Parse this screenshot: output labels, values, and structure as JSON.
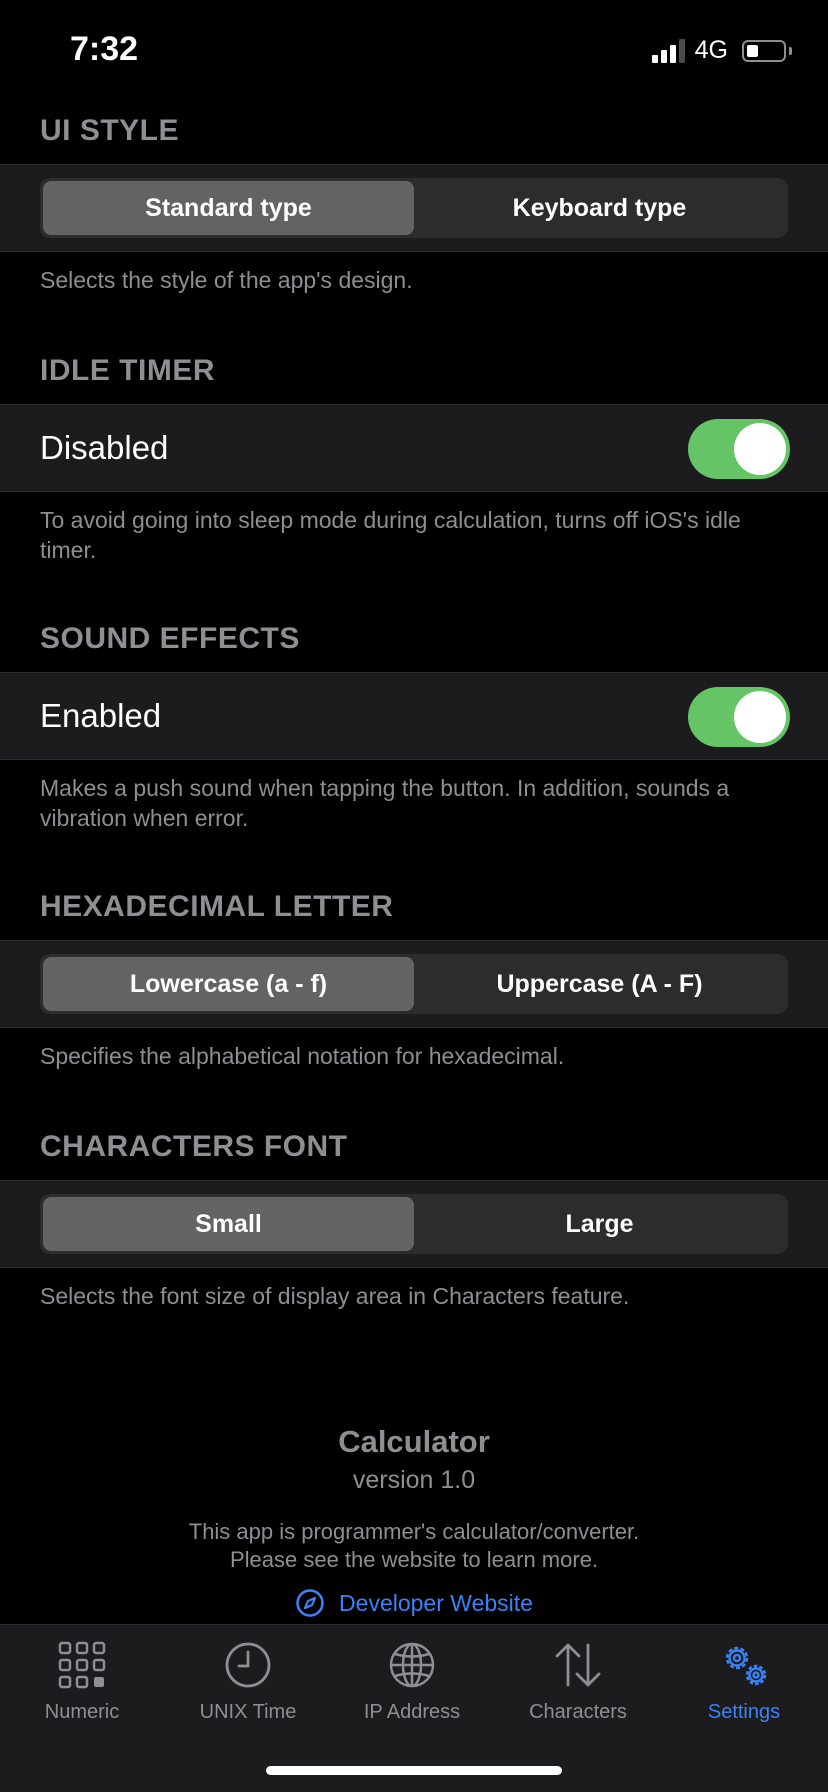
{
  "status_bar": {
    "time": "7:32",
    "network": "4G",
    "battery_percent": 25,
    "signal_bars": 3
  },
  "sections": {
    "ui_style": {
      "header": "UI STYLE",
      "options": [
        "Standard type",
        "Keyboard type"
      ],
      "selected": "Standard type",
      "footer": "Selects the style of the app's design."
    },
    "idle_timer": {
      "header": "IDLE TIMER",
      "label": "Disabled",
      "toggle_on": true,
      "footer": "To avoid going into sleep mode during calculation, turns off iOS's idle timer."
    },
    "sound_effects": {
      "header": "SOUND EFFECTS",
      "label": "Enabled",
      "toggle_on": true,
      "footer": "Makes a push sound when tapping the button. In addition, sounds a vibration when error."
    },
    "hex_letter": {
      "header": "HEXADECIMAL LETTER",
      "options": [
        "Lowercase (a - f)",
        "Uppercase (A - F)"
      ],
      "selected": "Lowercase (a - f)",
      "footer": "Specifies the alphabetical notation for hexadecimal."
    },
    "characters_font": {
      "header": "CHARACTERS FONT",
      "options": [
        "Small",
        "Large"
      ],
      "selected": "Small",
      "footer": "Selects the font size of display area in Characters feature."
    }
  },
  "about": {
    "title": "Calculator",
    "version": "version 1.0",
    "desc_line1": "This app is programmer's calculator/converter.",
    "desc_line2": "Please see the website to learn more.",
    "link_label": "Developer Website"
  },
  "tab_bar": {
    "tabs": [
      {
        "label": "Numeric",
        "icon": "grid-icon"
      },
      {
        "label": "UNIX Time",
        "icon": "clock-icon"
      },
      {
        "label": "IP Address",
        "icon": "globe-icon"
      },
      {
        "label": "Characters",
        "icon": "arrows-updown-icon"
      },
      {
        "label": "Settings",
        "icon": "gears-icon"
      }
    ],
    "active": "Settings"
  },
  "colors": {
    "accent": "#3b82f6",
    "toggle_on": "#65c466",
    "background": "#000000",
    "cell": "#1c1c1e",
    "secondary_text": "#8e8e93"
  }
}
